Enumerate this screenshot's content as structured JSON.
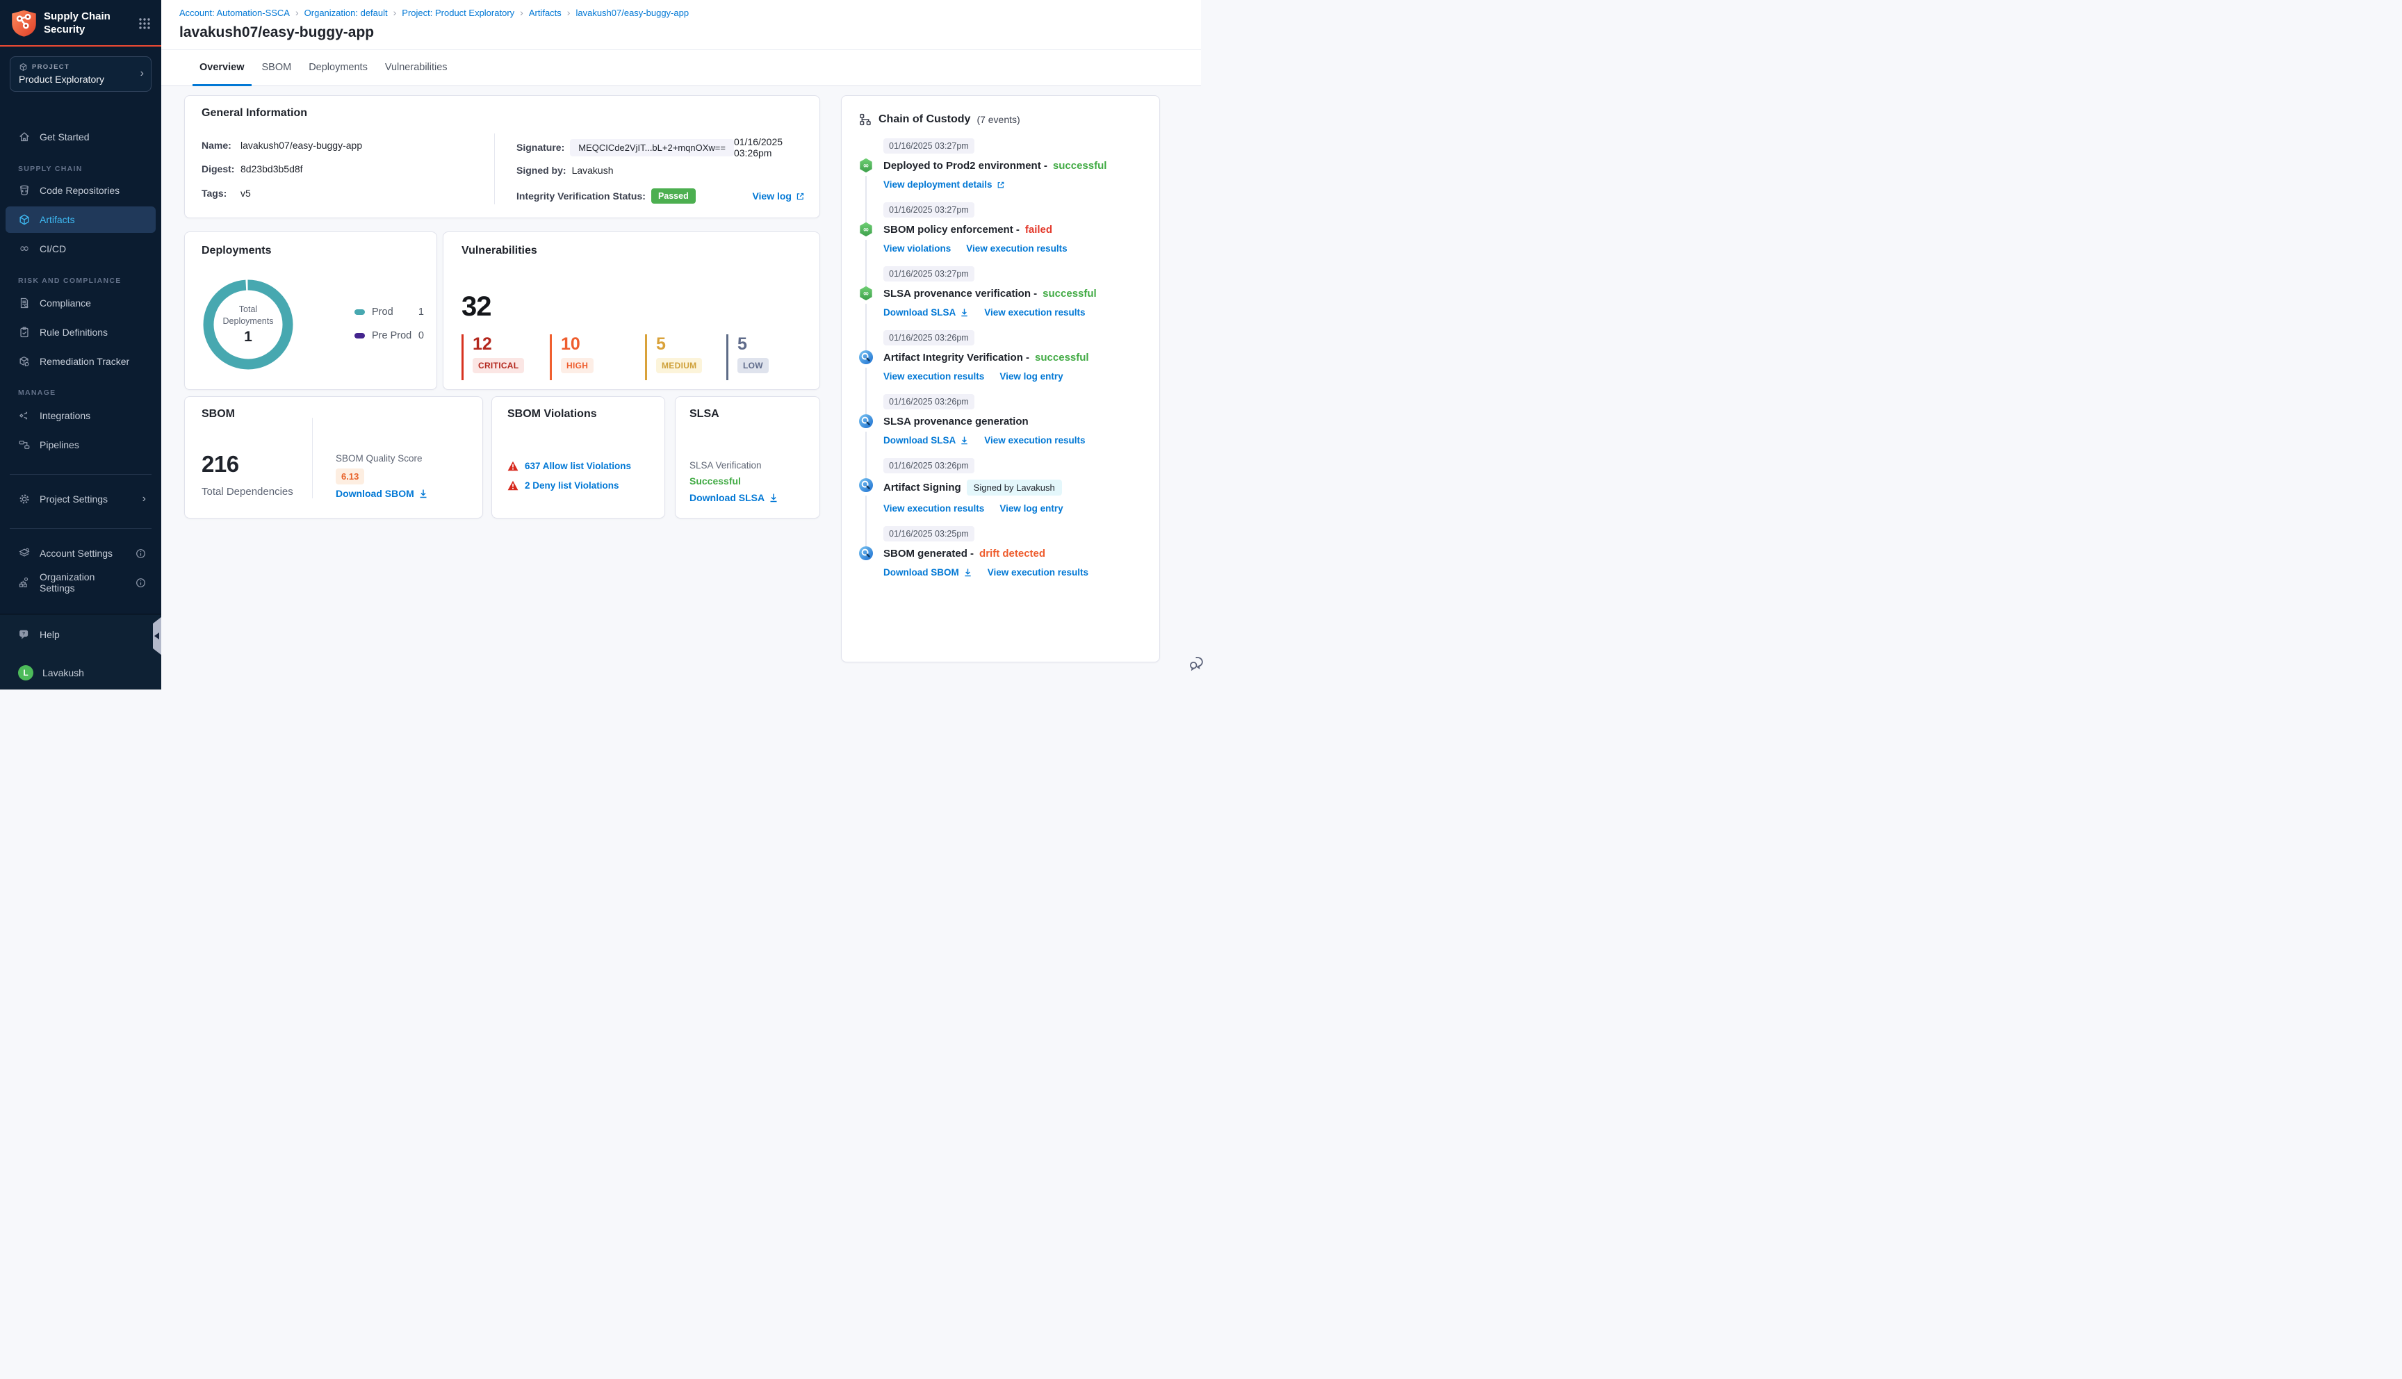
{
  "colors": {
    "accent_red": "#ee4a33",
    "link_blue": "#0278d5",
    "active_nav_blue": "#3eb9f2",
    "success_green": "#42ab45",
    "failed_red": "#e33a2c",
    "drift_orange": "#ee5d2e",
    "passed_badge_green": "#4caf50",
    "donut_teal": "#47a8b0",
    "pre_prod_purple": "#44258e",
    "critical": "#b3271d",
    "high": "#ee5d2e",
    "medium": "#d9a23a",
    "low": "#5f6b8a"
  },
  "sidebar": {
    "app_title_line1": "Supply Chain",
    "app_title_line2": "Security",
    "project_label": "PROJECT",
    "project_name": "Product Exploratory",
    "get_started": "Get Started",
    "section_supply_chain": "SUPPLY CHAIN",
    "code_repositories": "Code Repositories",
    "artifacts": "Artifacts",
    "cicd": "CI/CD",
    "section_risk": "RISK AND COMPLIANCE",
    "compliance": "Compliance",
    "rule_definitions": "Rule Definitions",
    "remediation_tracker": "Remediation Tracker",
    "section_manage": "MANAGE",
    "integrations": "Integrations",
    "pipelines": "Pipelines",
    "project_settings": "Project Settings",
    "account_settings": "Account Settings",
    "organization_settings": "Organization Settings",
    "help": "Help",
    "user_name": "Lavakush",
    "user_initial": "L"
  },
  "breadcrumb": {
    "separator": "›",
    "items": [
      "Account: Automation-SSCA",
      "Organization: default",
      "Project: Product Exploratory",
      "Artifacts",
      "lavakush07/easy-buggy-app"
    ]
  },
  "page_title": "lavakush07/easy-buggy-app",
  "tabs": {
    "overview": "Overview",
    "sbom": "SBOM",
    "deployments": "Deployments",
    "vulnerabilities": "Vulnerabilities"
  },
  "general_info": {
    "title": "General Information",
    "name_label": "Name:",
    "name": "lavakush07/easy-buggy-app",
    "digest_label": "Digest:",
    "digest": "8d23bd3b5d8f",
    "tags_label": "Tags:",
    "tags": "v5",
    "signature_label": "Signature:",
    "signature": "MEQCICde2VjIT...bL+2+mqnOXw==",
    "signature_time": "01/16/2025 03:26pm",
    "signed_by_label": "Signed by:",
    "signed_by": "Lavakush",
    "integrity_label": "Integrity Verification Status:",
    "integrity_status": "Passed",
    "view_log": "View log"
  },
  "deployments_card": {
    "title": "Deployments",
    "center_label_line1": "Total",
    "center_label_line2": "Deployments",
    "total": "1",
    "legend": [
      {
        "label": "Prod",
        "value": "1"
      },
      {
        "label": "Pre Prod",
        "value": "0"
      }
    ]
  },
  "vulnerabilities_card": {
    "title": "Vulnerabilities",
    "total": "32",
    "severities": [
      {
        "count": "12",
        "label": "CRITICAL"
      },
      {
        "count": "10",
        "label": "HIGH"
      },
      {
        "count": "5",
        "label": "MEDIUM"
      },
      {
        "count": "5",
        "label": "LOW"
      }
    ]
  },
  "sbom_card": {
    "title": "SBOM",
    "total_dependencies": "216",
    "total_label": "Total Dependencies",
    "quality_label": "SBOM Quality Score",
    "quality_score": "6.13",
    "download": "Download SBOM"
  },
  "sbom_violations_card": {
    "title": "SBOM Violations",
    "allow": "637 Allow list Violations",
    "deny": "2 Deny list Violations"
  },
  "slsa_card": {
    "title": "SLSA",
    "verification_label": "SLSA Verification",
    "verification_status": "Successful",
    "download": "Download SLSA"
  },
  "chain_of_custody": {
    "title": "Chain of Custody",
    "events_count": "(7 events)",
    "events": [
      {
        "time": "01/16/2025 03:27pm",
        "title": "Deployed to Prod2 environment -",
        "status": "successful",
        "links": [
          "View deployment details"
        ]
      },
      {
        "time": "01/16/2025 03:27pm",
        "title": "SBOM policy enforcement -",
        "status": "failed",
        "links": [
          "View violations",
          "View execution results"
        ]
      },
      {
        "time": "01/16/2025 03:27pm",
        "title": "SLSA provenance verification -",
        "status": "successful",
        "links": [
          "Download SLSA",
          "View execution results"
        ]
      },
      {
        "time": "01/16/2025 03:26pm",
        "title": "Artifact Integrity Verification -",
        "status": "successful",
        "links": [
          "View execution results",
          "View log entry"
        ]
      },
      {
        "time": "01/16/2025 03:26pm",
        "title": "SLSA provenance generation",
        "status": "",
        "links": [
          "Download SLSA",
          "View execution results"
        ]
      },
      {
        "time": "01/16/2025 03:26pm",
        "title": "Artifact Signing",
        "status": "",
        "badge": "Signed by Lavakush",
        "links": [
          "View execution results",
          "View log entry"
        ]
      },
      {
        "time": "01/16/2025 03:25pm",
        "title": "SBOM generated -",
        "status": "drift detected",
        "links": [
          "Download SBOM",
          "View execution results"
        ]
      }
    ]
  },
  "chart_data": {
    "type": "pie",
    "title": "Deployments",
    "categories": [
      "Prod",
      "Pre Prod"
    ],
    "values": [
      1,
      0
    ],
    "center_label": "Total Deployments",
    "center_value": 1,
    "legend_position": "right"
  }
}
